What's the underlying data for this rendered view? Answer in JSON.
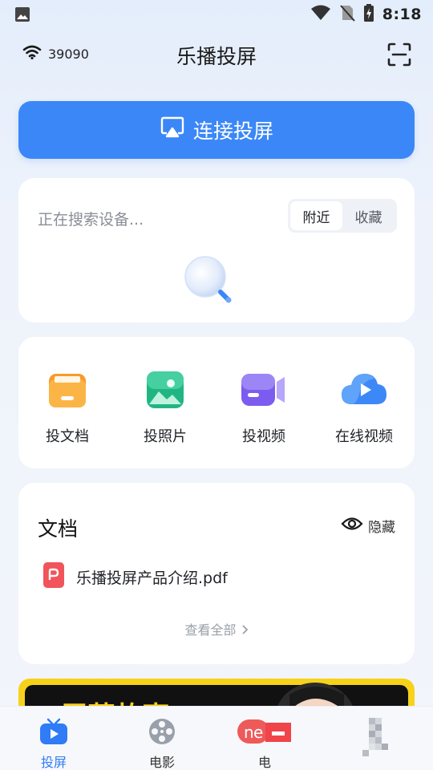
{
  "status_bar": {
    "time": "8:18",
    "icons": [
      "image-icon",
      "wifi-icon",
      "no-sim-icon",
      "battery-charging-icon"
    ]
  },
  "header": {
    "wifi_label": "39090",
    "title": "乐播投屏",
    "scan_icon": "scan-icon"
  },
  "connect": {
    "label": "连接投屏",
    "icon": "airplay-icon"
  },
  "devices": {
    "searching_text": "正在搜索设备...",
    "tabs": [
      {
        "label": "附近",
        "active": true
      },
      {
        "label": "收藏",
        "active": false
      }
    ]
  },
  "tools": [
    {
      "label": "投文档",
      "icon": "folder-icon",
      "color": "#f9a63a"
    },
    {
      "label": "投照片",
      "icon": "photo-icon",
      "color": "#2fc08d"
    },
    {
      "label": "投视频",
      "icon": "video-camera-icon",
      "color": "#7e63f2"
    },
    {
      "label": "在线视频",
      "icon": "cloud-play-icon",
      "color": "#3c86f6"
    }
  ],
  "documents": {
    "title": "文档",
    "hide_label": "隐藏",
    "items": [
      {
        "name": "乐播投屏产品介绍.pdf",
        "icon": "pdf-icon"
      }
    ],
    "view_all_label": "查看全部"
  },
  "banner": {
    "text": "“屏蓝故事”"
  },
  "bottom_nav": [
    {
      "label": "投屏",
      "icon": "tv-play-icon",
      "active": true
    },
    {
      "label": "电影",
      "icon": "film-reel-icon",
      "active": false
    },
    {
      "label": "电",
      "icon": "tv-channel-icon",
      "active": false
    },
    {
      "label": "",
      "icon": "qr-code-icon",
      "active": false
    }
  ],
  "colors": {
    "accent": "#3b87f7",
    "nav_active": "#2f7cf6",
    "banner_yellow": "#f7d21a"
  }
}
